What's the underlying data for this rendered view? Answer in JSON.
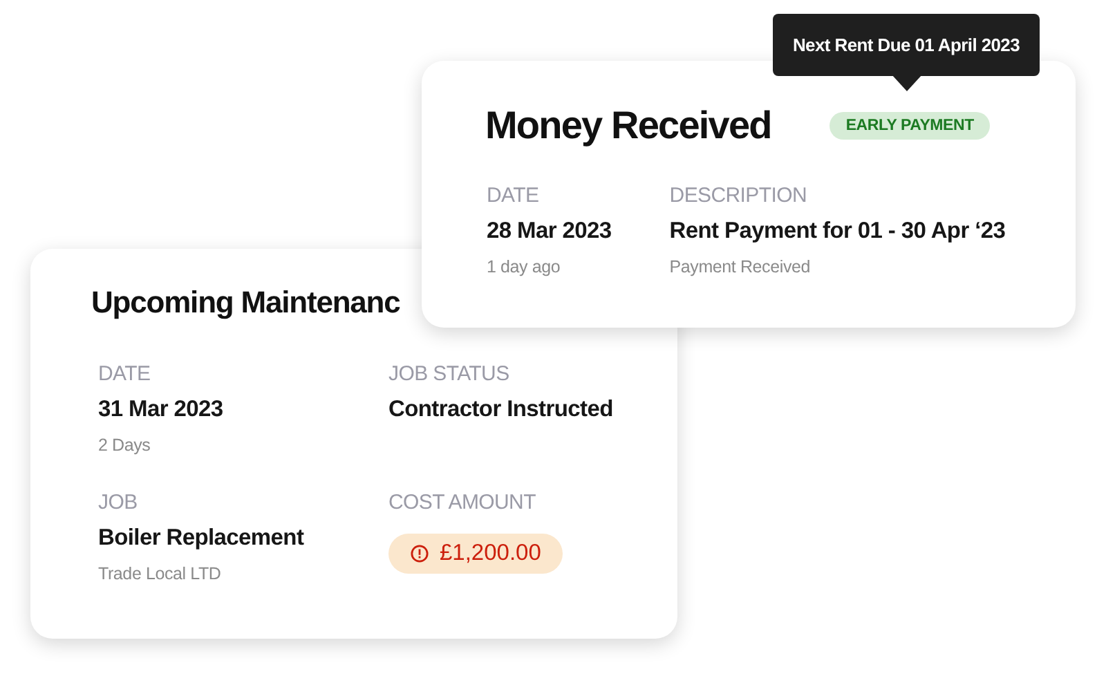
{
  "maintenance_card": {
    "title": "Upcoming Maintenanc",
    "fields": [
      {
        "label": "DATE",
        "value": "31 Mar 2023",
        "note": "2 Days",
        "kind": "text"
      },
      {
        "label": "JOB STATUS",
        "value": "Contractor Instructed",
        "kind": "text"
      },
      {
        "label": "JOB",
        "value": "Boiler Replacement",
        "note": "Trade Local LTD",
        "kind": "text"
      },
      {
        "label": "COST AMOUNT",
        "value": "£1,200.00",
        "kind": "amount"
      }
    ]
  },
  "payment_card": {
    "title": "Money Received",
    "badge": {
      "label": "EARLY PAYMENT"
    },
    "fields": [
      {
        "label": "DATE",
        "value": "28 Mar 2023",
        "note": "1 day ago",
        "kind": "text"
      },
      {
        "label": "DESCRIPTION",
        "value": "Rent Payment for 01 - 30 Apr ‘23",
        "note": "Payment Received",
        "kind": "text"
      }
    ]
  },
  "tooltip": {
    "text": "Next Rent Due 01 April 2023"
  }
}
